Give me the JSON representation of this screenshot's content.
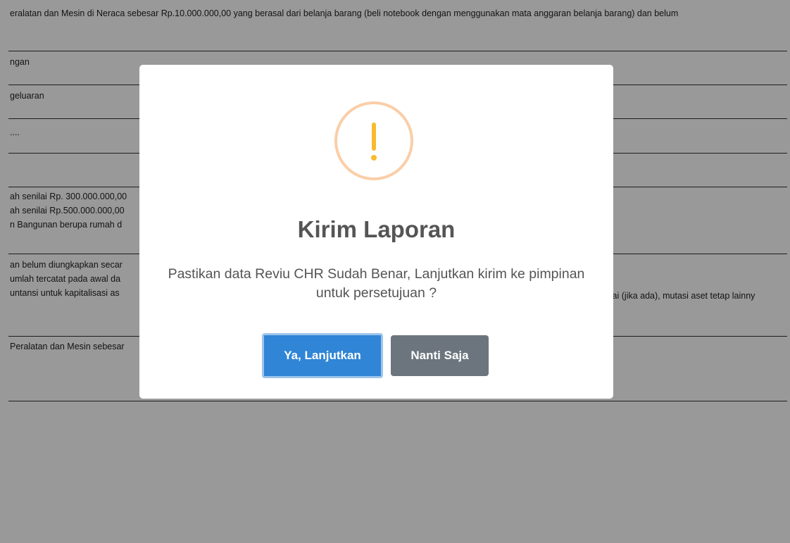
{
  "background": {
    "rows": [
      {
        "lines": [
          "eralatan dan Mesin di Neraca sebesar Rp.10.000.000,00 yang berasal dari belanja barang (beli notebook dengan menggunakan mata anggaran belanja barang) dan belum"
        ]
      },
      {
        "lines": [
          "ngan"
        ]
      },
      {
        "lines": [
          "geluaran"
        ]
      },
      {
        "lines": [
          "...."
        ]
      },
      {
        "lines": [
          ""
        ]
      },
      {
        "lines": [
          "ah senilai Rp. 300.000.000,00",
          "ah senilai Rp.500.000.000,00",
          "n Bangunan berupa rumah d"
        ]
      },
      {
        "lines": [
          "an belum diungkapkan secar",
          "",
          "umlah tercatat pada awal da",
          "untansi untuk kapitalisasi as"
        ],
        "right": "ilai (jika ada), mutasi aset tetap lainny"
      },
      {
        "lines": [
          "Peralatan dan Mesin sebesar"
        ]
      }
    ]
  },
  "modal": {
    "icon": "warning-exclamation-icon",
    "icon_ring_color": "#facea8",
    "icon_color": "#f8bb2c",
    "title": "Kirim Laporan",
    "text": "Pastikan data Reviu CHR Sudah Benar, Lanjutkan kirim ke pimpinan untuk persetujuan ?",
    "confirm_label": "Ya, Lanjutkan",
    "cancel_label": "Nanti Saja",
    "confirm_color": "#3085d6",
    "cancel_color": "#6c757d"
  }
}
